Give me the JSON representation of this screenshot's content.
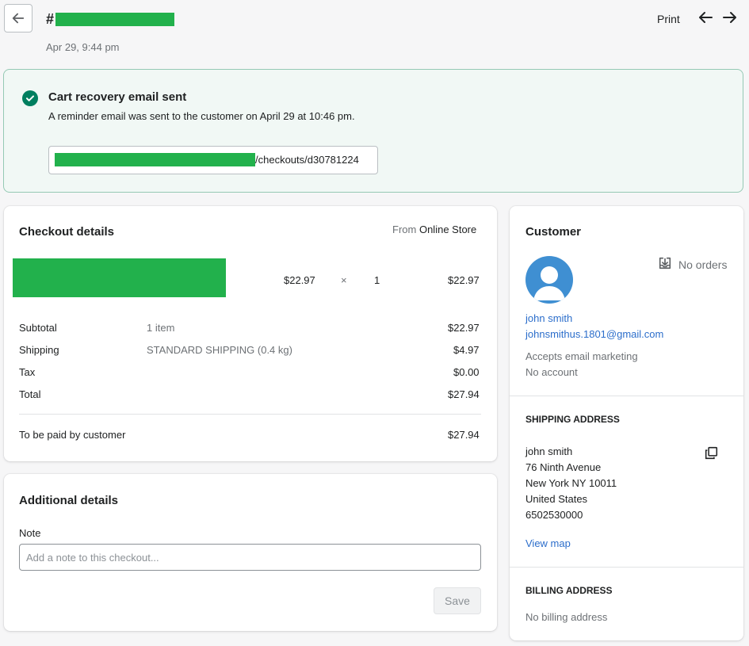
{
  "header": {
    "hash": "#",
    "date": "Apr 29, 9:44 pm",
    "print_label": "Print"
  },
  "banner": {
    "title": "Cart recovery email sent",
    "text": "A reminder email was sent to the customer on April 29 at 10:46 pm.",
    "url_suffix": "/checkouts/d30781224"
  },
  "checkout": {
    "title": "Checkout details",
    "source_prefix": "From",
    "source": "Online Store",
    "line_item": {
      "price": "$22.97",
      "times": "×",
      "qty": "1",
      "total": "$22.97"
    },
    "summary": [
      {
        "label": "Subtotal",
        "detail": "1 item",
        "amount": "$22.97"
      },
      {
        "label": "Shipping",
        "detail": "STANDARD SHIPPING (0.4 kg)",
        "amount": "$4.97"
      },
      {
        "label": "Tax",
        "detail": "",
        "amount": "$0.00"
      },
      {
        "label": "Total",
        "detail": "",
        "amount": "$27.94"
      }
    ],
    "to_be_paid_label": "To be paid by customer",
    "to_be_paid_amount": "$27.94"
  },
  "additional": {
    "title": "Additional details",
    "note_label": "Note",
    "note_placeholder": "Add a note to this checkout...",
    "note_value": "",
    "save_label": "Save"
  },
  "customer": {
    "title": "Customer",
    "orders": "No orders",
    "name": "john smith",
    "email": "johnsmithus.1801@gmail.com",
    "marketing": "Accepts email marketing",
    "account": "No account",
    "shipping_title": "SHIPPING ADDRESS",
    "shipping_lines": [
      "john smith",
      "76 Ninth Avenue",
      "New York NY 10011",
      "United States",
      "6502530000"
    ],
    "view_map": "View map",
    "billing_title": "BILLING ADDRESS",
    "billing_text": "No billing address"
  },
  "colors": {
    "success": "#007f5f",
    "banner_bg": "#f1f8f5",
    "link": "#2c6ecb",
    "redaction": "#22b14c"
  }
}
